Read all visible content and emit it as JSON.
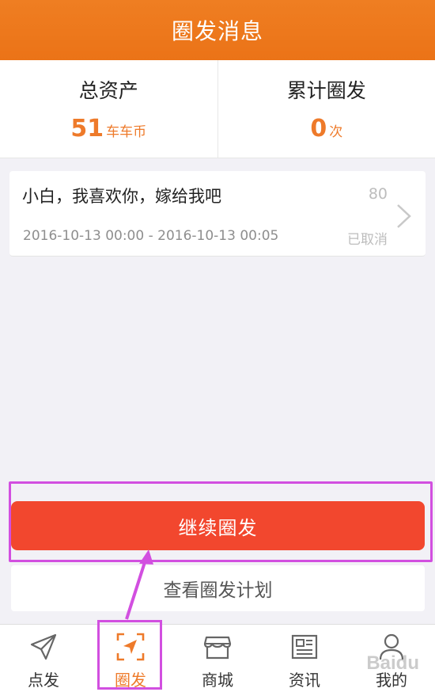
{
  "header": {
    "title": "圈发消息"
  },
  "stats": [
    {
      "label": "总资产",
      "value": "51",
      "unit": "车车币"
    },
    {
      "label": "累计圈发",
      "value": "0",
      "unit": "次"
    }
  ],
  "message": {
    "title": "小白，我喜欢你，嫁给我吧",
    "count": "80",
    "time_range": "2016-10-13 00:00 - 2016-10-13 00:05",
    "status": "已取消"
  },
  "actions": {
    "continue_label": "继续圈发",
    "view_plan_label": "查看圈发计划"
  },
  "nav": {
    "items": [
      {
        "label": "点发",
        "icon": "paper-plane-icon"
      },
      {
        "label": "圈发",
        "icon": "scan-send-icon",
        "active": true
      },
      {
        "label": "商城",
        "icon": "store-icon"
      },
      {
        "label": "资讯",
        "icon": "news-icon"
      },
      {
        "label": "我的",
        "icon": "profile-icon"
      }
    ]
  },
  "watermark": "Baidu",
  "colors": {
    "header": "#ee7a20",
    "accent": "#ee7a2a",
    "button": "#f2472e",
    "annotation": "#d24fe0"
  }
}
